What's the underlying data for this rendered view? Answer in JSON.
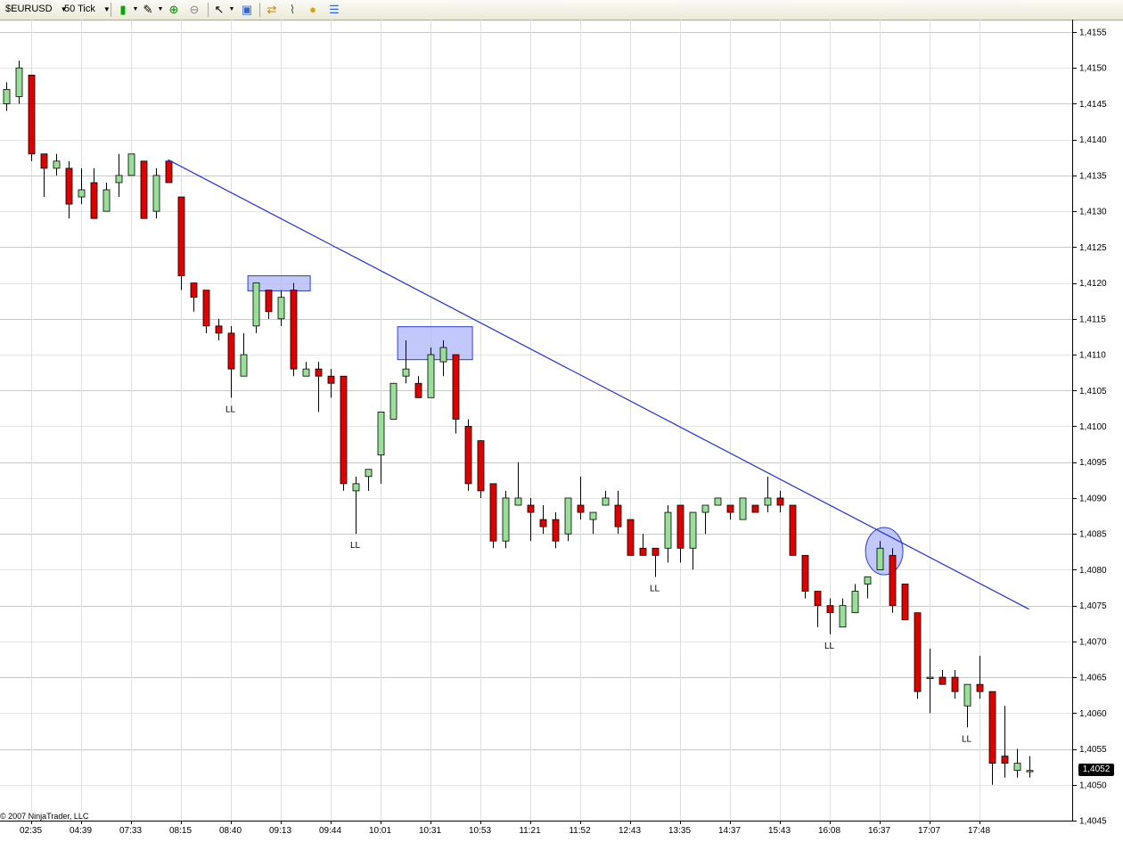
{
  "toolbar": {
    "instrument": "$EURUSD",
    "interval": "50 Tick",
    "icons": [
      "candlestick-icon",
      "pencil-icon",
      "zoom-in-icon",
      "zoom-out-icon",
      "cursor-icon",
      "properties-icon",
      "strategy-icon",
      "indicator-icon",
      "coin-icon",
      "data-box-icon"
    ]
  },
  "copyright": "© 2007 NinjaTrader, LLC",
  "colors": {
    "up": "#98e098",
    "down": "#e00000",
    "trendline": "#2030e0",
    "highlight": "#a8b0f8",
    "grid": "#d0d0d0"
  },
  "chart_data": {
    "type": "candlestick",
    "instrument": "$EURUSD",
    "interval": "50 Tick",
    "ylim": [
      1.4045,
      1.4155
    ],
    "y_ticks": [
      "1,4045",
      "1,4050",
      "1,4055",
      "1,4060",
      "1,4065",
      "1,4070",
      "1,4075",
      "1,4080",
      "1,4085",
      "1,4090",
      "1,4095",
      "1,4100",
      "1,4105",
      "1,4110",
      "1,4115",
      "1,4120",
      "1,4125",
      "1,4130",
      "1,4135",
      "1,4140",
      "1,4145",
      "1,4150",
      "1,4155"
    ],
    "x_labels": [
      {
        "i": 2,
        "t": "02:35"
      },
      {
        "i": 6,
        "t": "04:39"
      },
      {
        "i": 10,
        "t": "07:33"
      },
      {
        "i": 14,
        "t": "08:15"
      },
      {
        "i": 18,
        "t": "08:40"
      },
      {
        "i": 22,
        "t": "09:13"
      },
      {
        "i": 26,
        "t": "09:44"
      },
      {
        "i": 30,
        "t": "10:01"
      },
      {
        "i": 34,
        "t": "10:31"
      },
      {
        "i": 38,
        "t": "10:53"
      },
      {
        "i": 42,
        "t": "11:21"
      },
      {
        "i": 46,
        "t": "11:52"
      },
      {
        "i": 50,
        "t": "12:43"
      },
      {
        "i": 54,
        "t": "13:35"
      },
      {
        "i": 58,
        "t": "14:37"
      },
      {
        "i": 62,
        "t": "15:43"
      },
      {
        "i": 66,
        "t": "16:08"
      },
      {
        "i": 70,
        "t": "16:37"
      },
      {
        "i": 74,
        "t": "17:07"
      },
      {
        "i": 78,
        "t": "17:48"
      }
    ],
    "candles": [
      [
        1.4145,
        1.4147,
        1.4144,
        1.4148
      ],
      [
        1.4146,
        1.415,
        1.4145,
        1.4151
      ],
      [
        1.4149,
        1.4138,
        1.4137,
        1.4149
      ],
      [
        1.4138,
        1.4136,
        1.4132,
        1.4138
      ],
      [
        1.4136,
        1.4137,
        1.4135,
        1.4138
      ],
      [
        1.4136,
        1.4131,
        1.4129,
        1.4137
      ],
      [
        1.4132,
        1.4133,
        1.4131,
        1.4136
      ],
      [
        1.4134,
        1.4129,
        1.4129,
        1.4136
      ],
      [
        1.413,
        1.4133,
        1.413,
        1.4134
      ],
      [
        1.4134,
        1.4135,
        1.4132,
        1.4138
      ],
      [
        1.4135,
        1.4138,
        1.4135,
        1.4138
      ],
      [
        1.4137,
        1.4129,
        1.4129,
        1.4137
      ],
      [
        1.413,
        1.4135,
        1.4129,
        1.4136
      ],
      [
        1.4137,
        1.4134,
        1.4134,
        1.4137
      ],
      [
        1.4132,
        1.4121,
        1.4119,
        1.4132
      ],
      [
        1.412,
        1.4118,
        1.4116,
        1.412
      ],
      [
        1.4119,
        1.4114,
        1.4113,
        1.4119
      ],
      [
        1.4114,
        1.4113,
        1.4112,
        1.4115
      ],
      [
        1.4113,
        1.4108,
        1.4104,
        1.4114
      ],
      [
        1.4107,
        1.411,
        1.4107,
        1.4113
      ],
      [
        1.4114,
        1.412,
        1.4113,
        1.412
      ],
      [
        1.4119,
        1.4116,
        1.4115,
        1.4119
      ],
      [
        1.4115,
        1.4118,
        1.4114,
        1.4119
      ],
      [
        1.4119,
        1.4108,
        1.4107,
        1.412
      ],
      [
        1.4107,
        1.4108,
        1.4107,
        1.4109
      ],
      [
        1.4108,
        1.4107,
        1.4102,
        1.4109
      ],
      [
        1.4107,
        1.4106,
        1.4104,
        1.4108
      ],
      [
        1.4107,
        1.4092,
        1.4091,
        1.4107
      ],
      [
        1.4091,
        1.4092,
        1.4085,
        1.4093
      ],
      [
        1.4093,
        1.4094,
        1.4091,
        1.4094
      ],
      [
        1.4096,
        1.4102,
        1.4092,
        1.4102
      ],
      [
        1.4101,
        1.4106,
        1.4101,
        1.4106
      ],
      [
        1.4107,
        1.4108,
        1.4106,
        1.4112
      ],
      [
        1.4106,
        1.4104,
        1.4104,
        1.4107
      ],
      [
        1.4104,
        1.411,
        1.4104,
        1.4111
      ],
      [
        1.4109,
        1.4111,
        1.4107,
        1.4112
      ],
      [
        1.411,
        1.4101,
        1.4099,
        1.411
      ],
      [
        1.41,
        1.4092,
        1.4091,
        1.4101
      ],
      [
        1.4098,
        1.4091,
        1.409,
        1.4098
      ],
      [
        1.4092,
        1.4084,
        1.4083,
        1.4092
      ],
      [
        1.4084,
        1.409,
        1.4083,
        1.4091
      ],
      [
        1.4089,
        1.409,
        1.4089,
        1.4095
      ],
      [
        1.4089,
        1.4088,
        1.4084,
        1.409
      ],
      [
        1.4087,
        1.4086,
        1.4085,
        1.4089
      ],
      [
        1.4087,
        1.4084,
        1.4083,
        1.4088
      ],
      [
        1.4085,
        1.409,
        1.4084,
        1.409
      ],
      [
        1.4089,
        1.4088,
        1.4087,
        1.4093
      ],
      [
        1.4087,
        1.4088,
        1.4085,
        1.4088
      ],
      [
        1.4089,
        1.409,
        1.4089,
        1.4091
      ],
      [
        1.4089,
        1.4086,
        1.4085,
        1.4091
      ],
      [
        1.4087,
        1.4082,
        1.4082,
        1.4087
      ],
      [
        1.4083,
        1.4082,
        1.4082,
        1.4085
      ],
      [
        1.4083,
        1.4082,
        1.4079,
        1.4083
      ],
      [
        1.4083,
        1.4088,
        1.4081,
        1.4089
      ],
      [
        1.4089,
        1.4083,
        1.4081,
        1.4089
      ],
      [
        1.4083,
        1.4088,
        1.408,
        1.4088
      ],
      [
        1.4088,
        1.4089,
        1.4085,
        1.4089
      ],
      [
        1.4089,
        1.409,
        1.4089,
        1.409
      ],
      [
        1.4089,
        1.4088,
        1.4087,
        1.4089
      ],
      [
        1.4087,
        1.409,
        1.4087,
        1.409
      ],
      [
        1.4089,
        1.4088,
        1.4088,
        1.4089
      ],
      [
        1.4089,
        1.409,
        1.4088,
        1.4093
      ],
      [
        1.409,
        1.4089,
        1.4088,
        1.4091
      ],
      [
        1.4089,
        1.4082,
        1.4082,
        1.4089
      ],
      [
        1.4082,
        1.4077,
        1.4076,
        1.4082
      ],
      [
        1.4077,
        1.4075,
        1.4072,
        1.4077
      ],
      [
        1.4075,
        1.4074,
        1.4071,
        1.4076
      ],
      [
        1.4072,
        1.4075,
        1.4072,
        1.4076
      ],
      [
        1.4074,
        1.4077,
        1.4074,
        1.4078
      ],
      [
        1.4078,
        1.4079,
        1.4076,
        1.4079
      ],
      [
        1.408,
        1.4083,
        1.408,
        1.4084
      ],
      [
        1.4082,
        1.4075,
        1.4074,
        1.4083
      ],
      [
        1.4078,
        1.4073,
        1.4073,
        1.4078
      ],
      [
        1.4074,
        1.4063,
        1.4062,
        1.4074
      ],
      [
        1.4065,
        1.4065,
        1.406,
        1.4069
      ],
      [
        1.4065,
        1.4064,
        1.4064,
        1.4066
      ],
      [
        1.4065,
        1.4063,
        1.4062,
        1.4066
      ],
      [
        1.4061,
        1.4064,
        1.4058,
        1.4064
      ],
      [
        1.4064,
        1.4063,
        1.4062,
        1.4068
      ],
      [
        1.4063,
        1.4053,
        1.405,
        1.4063
      ],
      [
        1.4054,
        1.4053,
        1.4051,
        1.4061
      ],
      [
        1.4052,
        1.4053,
        1.4051,
        1.4055
      ],
      [
        1.4052,
        1.4052,
        1.4051,
        1.4054
      ]
    ],
    "last_price": "1,4052",
    "annotations": {
      "ll_labels": [
        {
          "i": 18,
          "text": "LL"
        },
        {
          "i": 28,
          "text": "LL"
        },
        {
          "i": 52,
          "text": "LL"
        },
        {
          "i": 66,
          "text": "LL"
        },
        {
          "i": 77,
          "text": "LL"
        }
      ],
      "trendline": {
        "from": {
          "i": 13,
          "price": 1.41372
        },
        "to": {
          "i": 82,
          "price": 1.40745
        }
      },
      "rectangles": [
        {
          "i0": 19.4,
          "i1": 24.4,
          "p_top": 1.4121,
          "p_bottom": 1.41189
        },
        {
          "i0": 31.4,
          "i1": 37.4,
          "p_top": 1.41139,
          "p_bottom": 1.41093
        }
      ],
      "ellipses": [
        {
          "i_center": 70.4,
          "p_center": 1.40826,
          "i_radius": 1.5,
          "p_radius": 0.00033
        }
      ]
    }
  }
}
